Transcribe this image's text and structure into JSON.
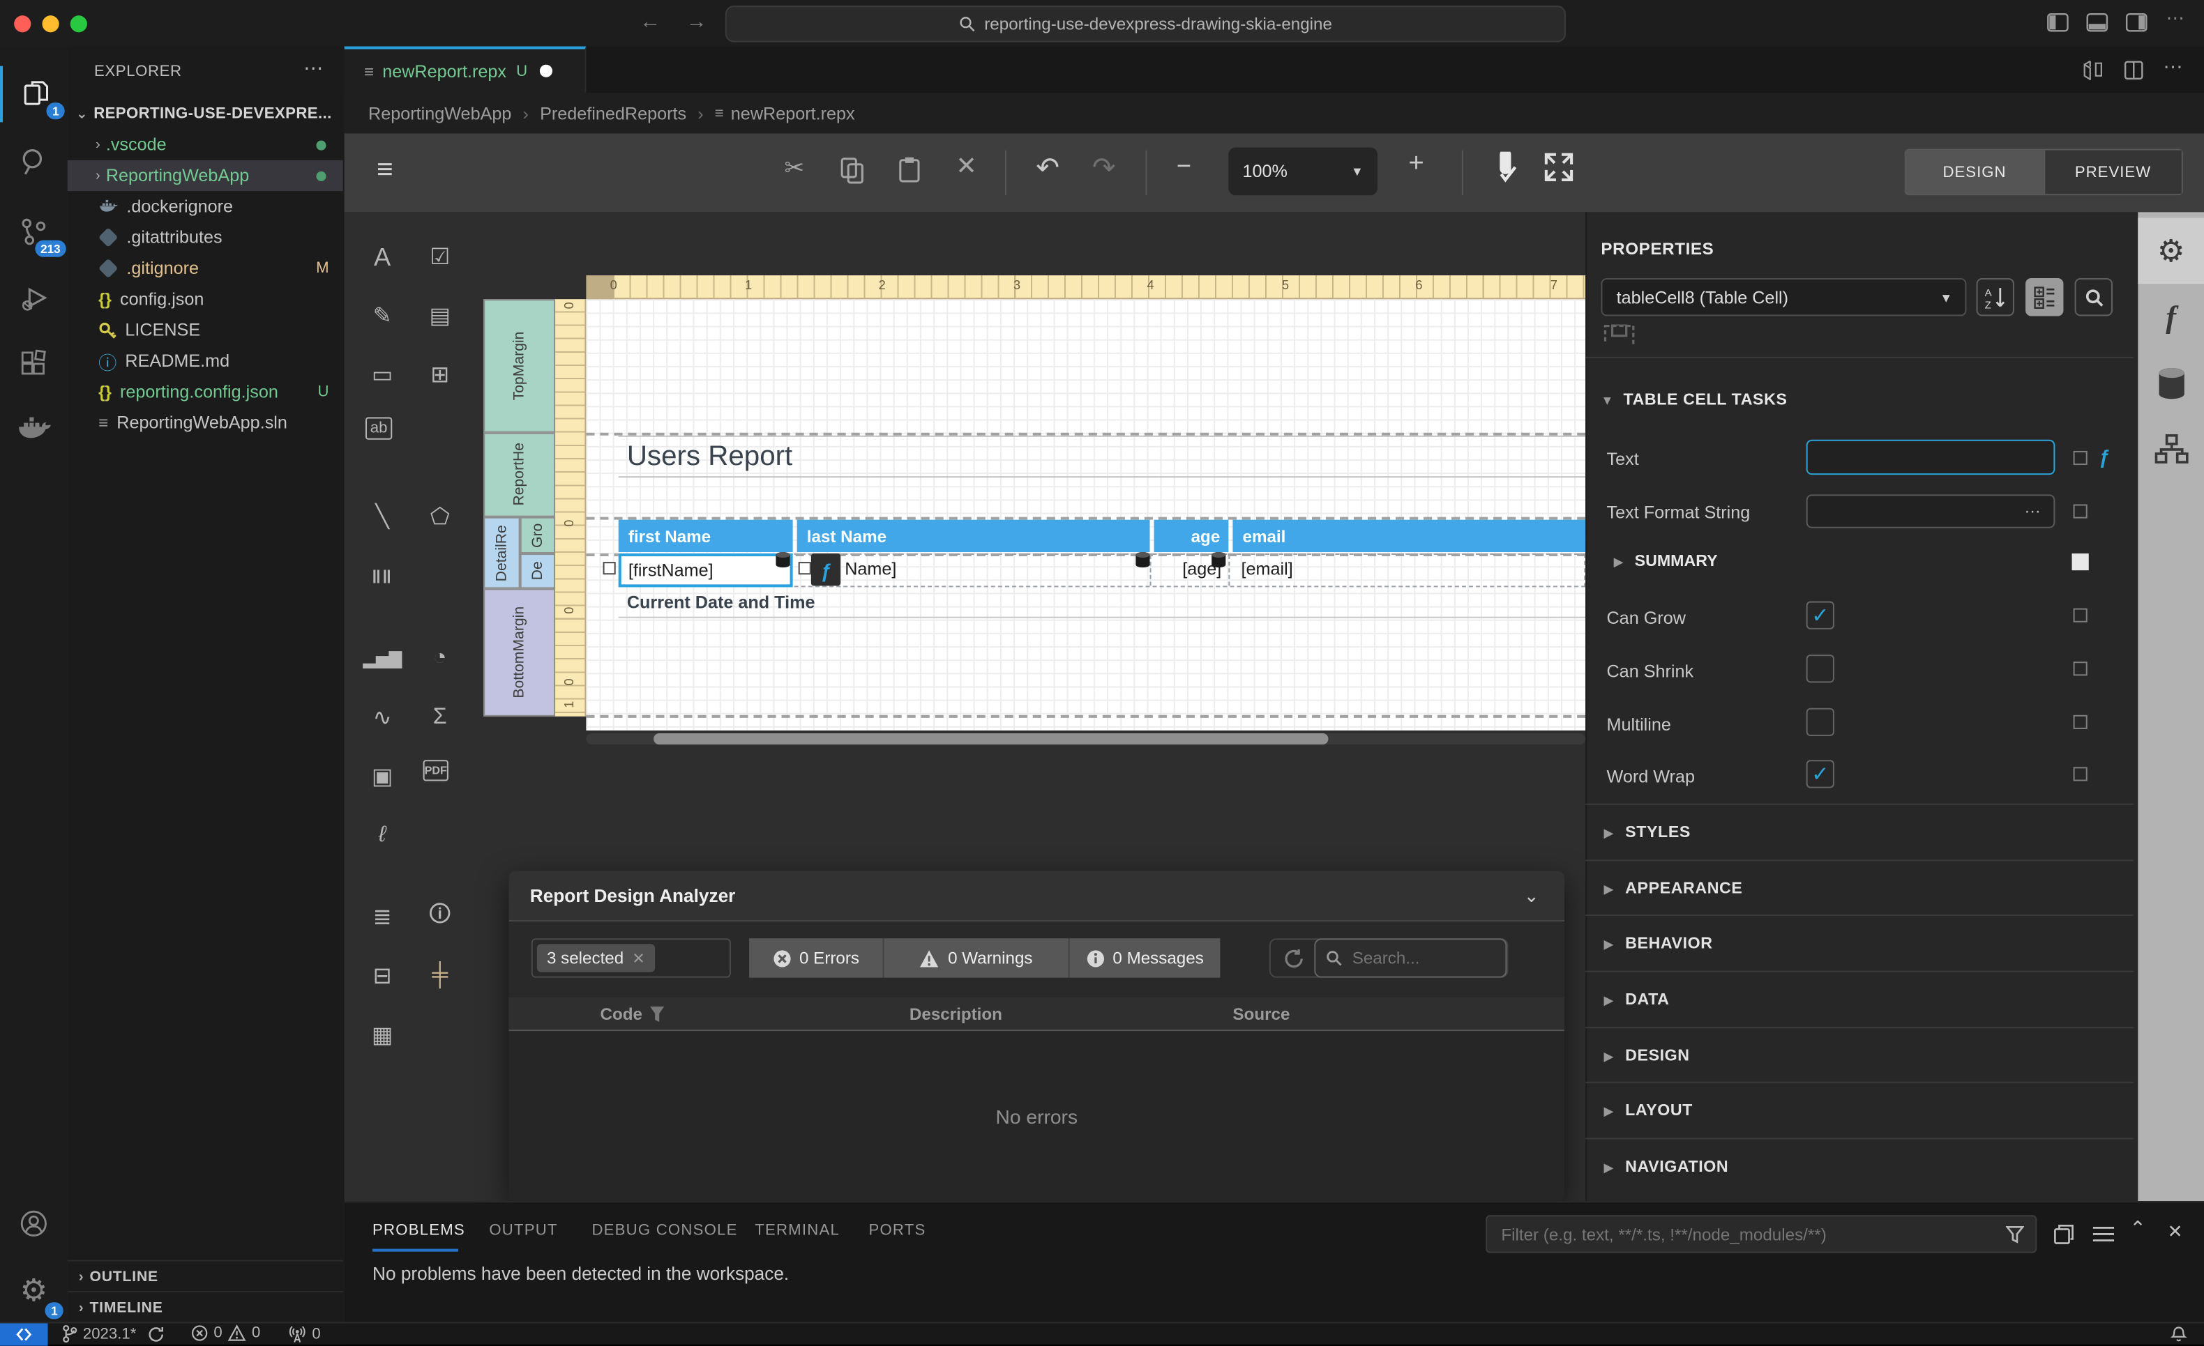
{
  "titlebar": {
    "search": "reporting-use-devexpress-drawing-skia-engine"
  },
  "tabbar": {
    "tab": "newReport.repx",
    "dirty": "U"
  },
  "breadcrumb": {
    "items": [
      "ReportingWebApp",
      "PredefinedReports",
      "newReport.repx"
    ],
    "sep": "›"
  },
  "activity": {
    "explorer_badge": "1",
    "scm_badge": "213",
    "settings_badge": "1"
  },
  "explorer": {
    "title": "EXPLORER",
    "root": "REPORTING-USE-DEVEXPRE...",
    "items": [
      {
        "name": ".vscode",
        "badge": ""
      },
      {
        "name": "ReportingWebApp",
        "badge": ""
      },
      {
        "name": ".dockerignore",
        "badge": ""
      },
      {
        "name": ".gitattributes",
        "badge": ""
      },
      {
        "name": ".gitignore",
        "badge": "M"
      },
      {
        "name": "config.json",
        "badge": ""
      },
      {
        "name": "LICENSE",
        "badge": ""
      },
      {
        "name": "README.md",
        "badge": ""
      },
      {
        "name": "reporting.config.json",
        "badge": "U"
      },
      {
        "name": "ReportingWebApp.sln",
        "badge": ""
      }
    ],
    "outline": "OUTLINE",
    "timeline": "TIMELINE"
  },
  "designer_toolbar": {
    "zoom": "100%",
    "design": "DESIGN",
    "preview": "PREVIEW"
  },
  "ruler": {
    "h": [
      "0",
      "1",
      "2",
      "3",
      "4",
      "5",
      "6",
      "7"
    ],
    "v": [
      "0",
      "0",
      "0",
      "0",
      "1"
    ]
  },
  "bands": {
    "top": "TopMargin",
    "header": "ReportHe",
    "detail": "DetailRe",
    "group": "Gro",
    "det2": "De",
    "bottom": "BottomMargin"
  },
  "report": {
    "title": "Users Report",
    "columns": [
      "first Name",
      "last Name",
      "age",
      "email"
    ],
    "cells": {
      "first": "[firstName]",
      "last_visible": "Name]",
      "age": "[age]",
      "email": "[email]"
    },
    "datetime": "Current Date and Time",
    "fx": "ƒ"
  },
  "analyzer": {
    "title": "Report Design Analyzer",
    "chip": "3 selected",
    "errors": "0 Errors",
    "warnings": "0 Warnings",
    "messages": "0 Messages",
    "search_placeholder": "Search...",
    "columns": [
      "Code",
      "Description",
      "Source"
    ],
    "empty": "No errors"
  },
  "properties": {
    "title": "PROPERTIES",
    "selector": "tableCell8 (Table Cell)",
    "section": "TABLE CELL TASKS",
    "text_label": "Text",
    "format_label": "Text Format String",
    "summary": "SUMMARY",
    "fx": "ƒ",
    "checks": [
      {
        "label": "Can Grow",
        "checked": "✓"
      },
      {
        "label": "Can Shrink",
        "checked": ""
      },
      {
        "label": "Multiline",
        "checked": ""
      },
      {
        "label": "Word Wrap",
        "checked": "✓"
      }
    ],
    "sections": [
      "STYLES",
      "APPEARANCE",
      "BEHAVIOR",
      "DATA",
      "DESIGN",
      "LAYOUT",
      "NAVIGATION"
    ]
  },
  "bottom_panel": {
    "tabs": [
      "PROBLEMS",
      "OUTPUT",
      "DEBUG CONSOLE",
      "TERMINAL",
      "PORTS"
    ],
    "filter_placeholder": "Filter (e.g. text, **/*.ts, !**/node_modules/**)",
    "message": "No problems have been detected in the workspace."
  },
  "status_bar": {
    "branch": "2023.1*",
    "errors": "0",
    "warnings": "0",
    "ports": "0"
  }
}
